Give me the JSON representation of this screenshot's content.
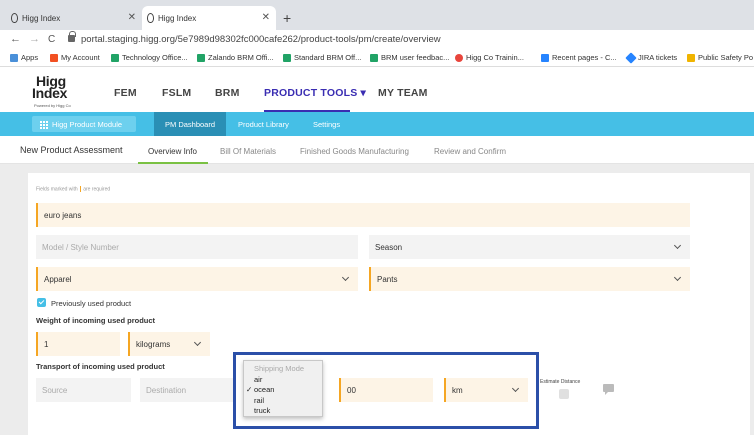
{
  "browser": {
    "tabs": [
      {
        "label": "Higg Index",
        "active": false
      },
      {
        "label": "Higg Index",
        "active": true
      }
    ],
    "new_tab": "+",
    "nav": {
      "back": "←",
      "forward": "→",
      "reload": "C"
    },
    "url": "portal.staging.higg.org/5e7989d98302fc000cafe262/product-tools/pm/create/overview",
    "bookmarks": [
      {
        "label": "Apps",
        "color": "#4a90d9"
      },
      {
        "label": "My Account",
        "color": "#f25022"
      },
      {
        "label": "Technology Office...",
        "color": "#21a366"
      },
      {
        "label": "Zalando BRM Offi...",
        "color": "#21a366"
      },
      {
        "label": "Standard BRM Off...",
        "color": "#21a366"
      },
      {
        "label": "BRM user feedbac...",
        "color": "#21a366"
      },
      {
        "label": "Higg Co Trainin...",
        "color": "#e8453c"
      },
      {
        "label": "Recent pages - C...",
        "color": "#2684ff"
      },
      {
        "label": "JIRA tickets",
        "color": "#2684ff"
      },
      {
        "label": "Public Safety Po",
        "color": "#f0b400"
      }
    ]
  },
  "header": {
    "logo_line1": "Higg",
    "logo_line2": "Index",
    "logo_sub": "Powered by Higg Co",
    "nav": [
      {
        "label": "FEM",
        "active": false
      },
      {
        "label": "FSLM",
        "active": false
      },
      {
        "label": "BRM",
        "active": false
      },
      {
        "label": "PRODUCT TOOLS ▾",
        "active": true
      },
      {
        "label": "MY TEAM",
        "active": false
      }
    ]
  },
  "subnav": {
    "module_label": "Higg Product Module",
    "items": [
      {
        "label": "PM Dashboard",
        "active": true
      },
      {
        "label": "Product Library",
        "active": false
      },
      {
        "label": "Settings",
        "active": false
      }
    ]
  },
  "assessment": {
    "title": "New Product Assessment",
    "tabs": [
      {
        "label": "Overview Info",
        "active": true
      },
      {
        "label": "Bill Of Materials",
        "active": false
      },
      {
        "label": "Finished Goods Manufacturing",
        "active": false
      },
      {
        "label": "Review and Confirm",
        "active": false
      }
    ]
  },
  "form": {
    "required_note_pre": "Fields marked with",
    "required_note_post": "are required",
    "product_name": "euro jeans",
    "model_placeholder": "Model / Style Number",
    "season": "Season",
    "category": "Apparel",
    "subcategory": "Pants",
    "previously_used_label": "Previously used product",
    "previously_used_checked": true,
    "weight_label": "Weight of incoming used product",
    "weight_value": "1",
    "weight_unit": "kilograms",
    "transport_label": "Transport of incoming used product",
    "source_placeholder": "Source",
    "destination_placeholder": "Destination",
    "distance_value": "00",
    "distance_unit": "km",
    "estimate_label": "Estimate Distance"
  },
  "shipping_dropdown": {
    "placeholder": "Shipping Mode",
    "options": [
      "air",
      "ocean",
      "rail",
      "truck"
    ],
    "selected": "ocean",
    "tick": "✓"
  },
  "colors": {
    "accent_blue": "#45bfe6",
    "active_nav": "#3a2db2",
    "required_orange": "#f5a623",
    "tab_green": "#7ac143",
    "highlight": "#2b4fa8"
  }
}
